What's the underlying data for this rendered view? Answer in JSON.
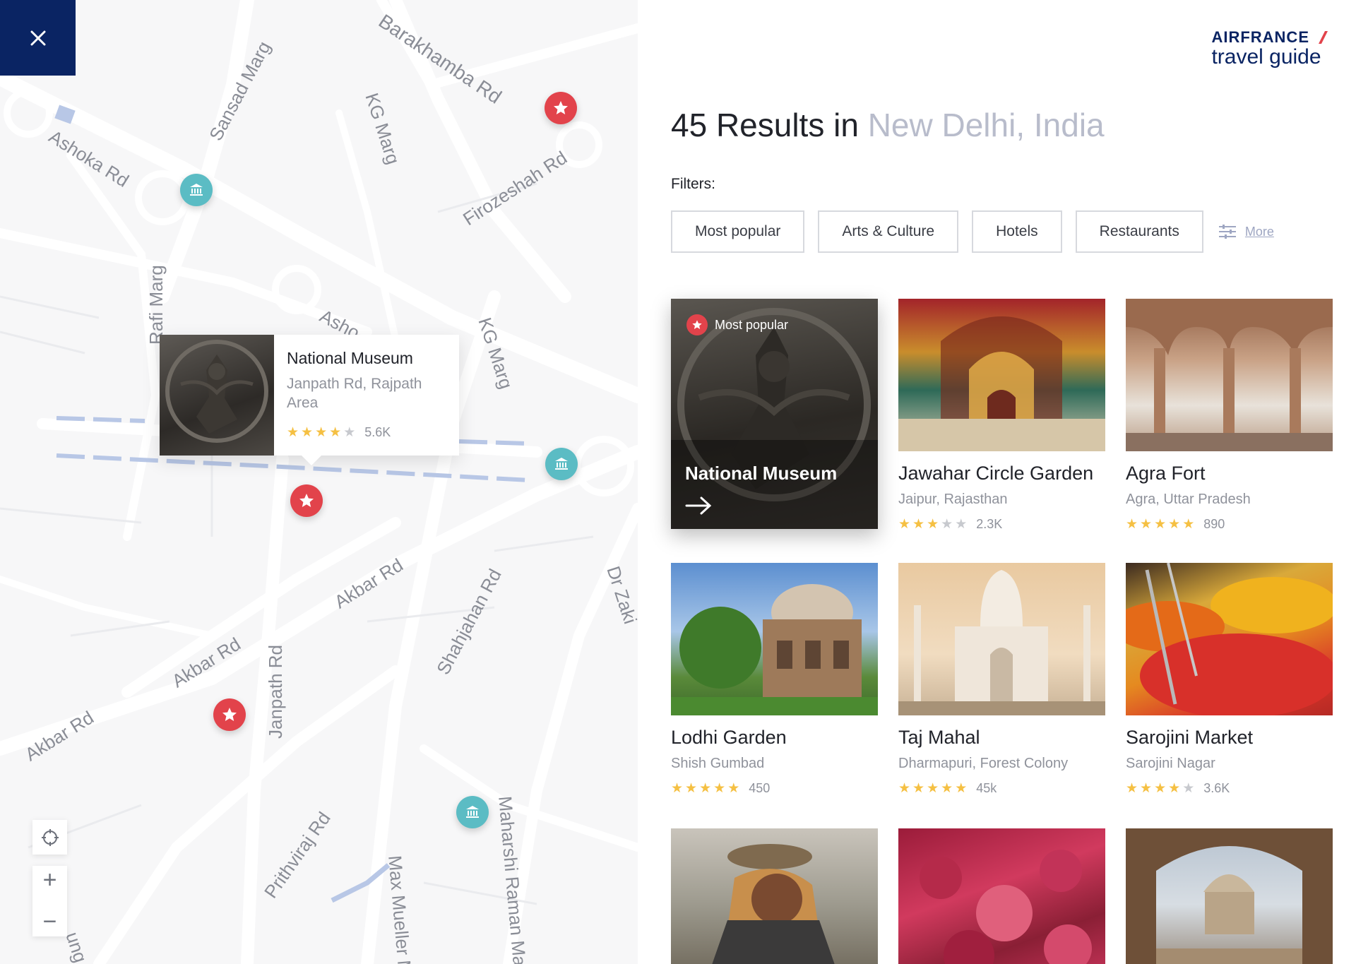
{
  "map": {
    "streets": [
      "Barakhamba Rd",
      "Sansad Marg",
      "KG Marg",
      "Ashoka Rd",
      "Firozeshah Rd",
      "Rafi Marg",
      "Asho",
      "KG Marg",
      "Akbar Rd",
      "Akbar Rd",
      "Akbar Rd",
      "Janpath Rd",
      "Shahjahan Rd",
      "Dr Zaki",
      "Prithviraj Rd",
      "Max Mueller M",
      "Maharshi Raman Ma",
      "ung"
    ],
    "popup": {
      "title": "National Museum",
      "address": "Janpath Rd, Rajpath Area",
      "rating": 4,
      "count": "5.6K"
    }
  },
  "header": {
    "logo_line1": "AIRFRANCE",
    "logo_line2": "travel guide",
    "results_prefix": "45 Results in ",
    "place": "New Delhi, India"
  },
  "filters": {
    "label": "Filters:",
    "items": [
      "Most popular",
      "Arts & Culture",
      "Hotels",
      "Restaurants"
    ],
    "more": "More"
  },
  "cards": [
    {
      "title": "National Museum",
      "badge": "Most popular",
      "featured": true
    },
    {
      "title": "Jawahar Circle Garden",
      "sub": "Jaipur, Rajasthan",
      "rating": 3.5,
      "count": "2.3K"
    },
    {
      "title": "Agra Fort",
      "sub": "Agra, Uttar Pradesh",
      "rating": 5,
      "count": "890"
    },
    {
      "title": "Lodhi Garden",
      "sub": "Shish Gumbad",
      "rating": 5,
      "count": "450"
    },
    {
      "title": "Taj Mahal",
      "sub": "Dharmapuri, Forest Colony",
      "rating": 5,
      "count": "45k"
    },
    {
      "title": "Sarojini Market",
      "sub": "Sarojini Nagar",
      "rating": 4.5,
      "count": "3.6K"
    },
    {
      "title": "",
      "sub": "",
      "rating": 0,
      "count": ""
    },
    {
      "title": "",
      "sub": "",
      "rating": 0,
      "count": ""
    },
    {
      "title": "",
      "sub": "",
      "rating": 0,
      "count": ""
    }
  ],
  "colors": {
    "brand": "#0a2463",
    "star_pin": "#e2434b",
    "museum_pin": "#5bbcc4",
    "place": "#b8bccb"
  }
}
